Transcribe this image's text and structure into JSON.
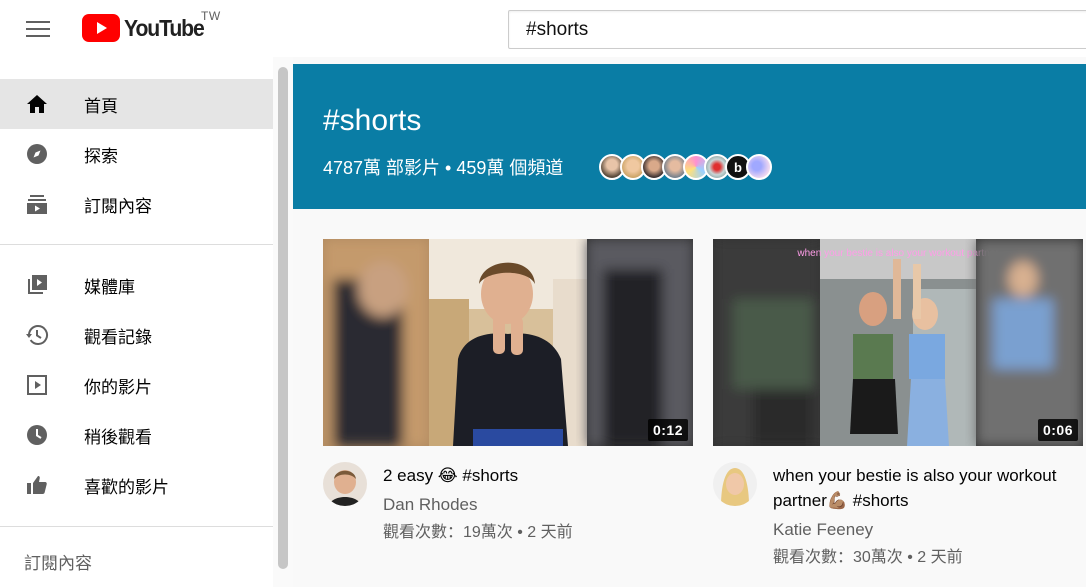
{
  "header": {
    "logo_text": "YouTube",
    "region": "TW",
    "search_value": "#shorts"
  },
  "sidebar": {
    "items": [
      {
        "label": "首頁",
        "icon": "home-icon"
      },
      {
        "label": "探索",
        "icon": "compass-icon"
      },
      {
        "label": "訂閱內容",
        "icon": "subscriptions-icon"
      },
      {
        "label": "媒體庫",
        "icon": "library-icon"
      },
      {
        "label": "觀看記錄",
        "icon": "history-icon"
      },
      {
        "label": "你的影片",
        "icon": "play-square-icon"
      },
      {
        "label": "稍後觀看",
        "icon": "clock-icon"
      },
      {
        "label": "喜歡的影片",
        "icon": "thumbs-up-icon"
      }
    ],
    "section_title": "訂閱內容"
  },
  "banner": {
    "title": "#shorts",
    "stats": "4787萬 部影片 • 459萬 個頻道",
    "color": "#0a7da5"
  },
  "videos": [
    {
      "title": "2 easy 😂 #shorts",
      "channel": "Dan Rhodes",
      "meta": "觀看次數：19萬次 • 2 天前",
      "duration": "0:12"
    },
    {
      "title": "when your bestie is also your workout partner💪🏽 #shorts",
      "channel": "Katie Feeney",
      "meta": "觀看次數：30萬次 • 2 天前",
      "duration": "0:06",
      "thumb_caption": "when your bestie is also your workout partner"
    }
  ],
  "colors": {
    "brand_red": "#ff0000",
    "active_bg": "#e5e5e5"
  }
}
